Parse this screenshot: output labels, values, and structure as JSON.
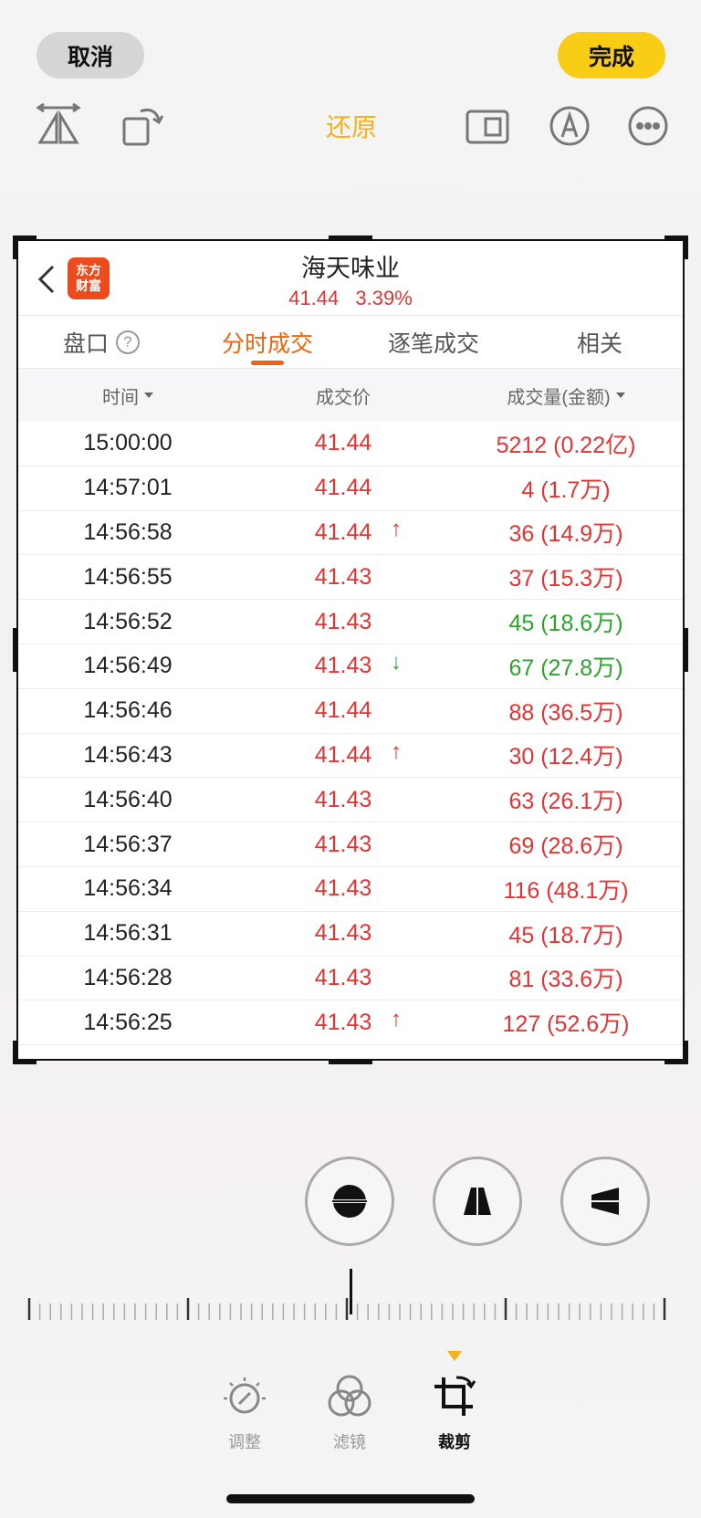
{
  "topbar": {
    "cancel_label": "取消",
    "done_label": "完成",
    "restore_label": "还原"
  },
  "app": {
    "logo_line1": "东方",
    "logo_line2": "财富",
    "stock_name": "海天味业",
    "price": "41.44",
    "change_pct": "3.39%"
  },
  "tabs": [
    {
      "label": "盘口"
    },
    {
      "label": "分时成交"
    },
    {
      "label": "逐笔成交"
    },
    {
      "label": "相关"
    }
  ],
  "table": {
    "headers": [
      "时间",
      "成交价",
      "成交量(金额)"
    ],
    "rows": [
      {
        "time": "15:00:00",
        "price": "41.44",
        "arrow": "",
        "volume": "5212 (0.22亿)",
        "vol_color": "red"
      },
      {
        "time": "14:57:01",
        "price": "41.44",
        "arrow": "",
        "volume": "4 (1.7万)",
        "vol_color": "red"
      },
      {
        "time": "14:56:58",
        "price": "41.44",
        "arrow": "↑",
        "volume": "36 (14.9万)",
        "vol_color": "red"
      },
      {
        "time": "14:56:55",
        "price": "41.43",
        "arrow": "",
        "volume": "37 (15.3万)",
        "vol_color": "red"
      },
      {
        "time": "14:56:52",
        "price": "41.43",
        "arrow": "",
        "volume": "45 (18.6万)",
        "vol_color": "green"
      },
      {
        "time": "14:56:49",
        "price": "41.43",
        "arrow": "↓",
        "volume": "67 (27.8万)",
        "vol_color": "green"
      },
      {
        "time": "14:56:46",
        "price": "41.44",
        "arrow": "",
        "volume": "88 (36.5万)",
        "vol_color": "red"
      },
      {
        "time": "14:56:43",
        "price": "41.44",
        "arrow": "↑",
        "volume": "30 (12.4万)",
        "vol_color": "red"
      },
      {
        "time": "14:56:40",
        "price": "41.43",
        "arrow": "",
        "volume": "63 (26.1万)",
        "vol_color": "red"
      },
      {
        "time": "14:56:37",
        "price": "41.43",
        "arrow": "",
        "volume": "69 (28.6万)",
        "vol_color": "red"
      },
      {
        "time": "14:56:34",
        "price": "41.43",
        "arrow": "",
        "volume": "116 (48.1万)",
        "vol_color": "red"
      },
      {
        "time": "14:56:31",
        "price": "41.43",
        "arrow": "",
        "volume": "45 (18.7万)",
        "vol_color": "red"
      },
      {
        "time": "14:56:28",
        "price": "41.43",
        "arrow": "",
        "volume": "81 (33.6万)",
        "vol_color": "red"
      },
      {
        "time": "14:56:25",
        "price": "41.43",
        "arrow": "↑",
        "volume": "127 (52.6万)",
        "vol_color": "red"
      }
    ]
  },
  "modes": [
    {
      "label": "调整"
    },
    {
      "label": "滤镜"
    },
    {
      "label": "裁剪"
    }
  ],
  "colors": {
    "accent": "#f4b11c",
    "done": "#f9cc15",
    "up": "#e53333",
    "down": "#2aa52a",
    "tab_active": "#f0640f"
  }
}
